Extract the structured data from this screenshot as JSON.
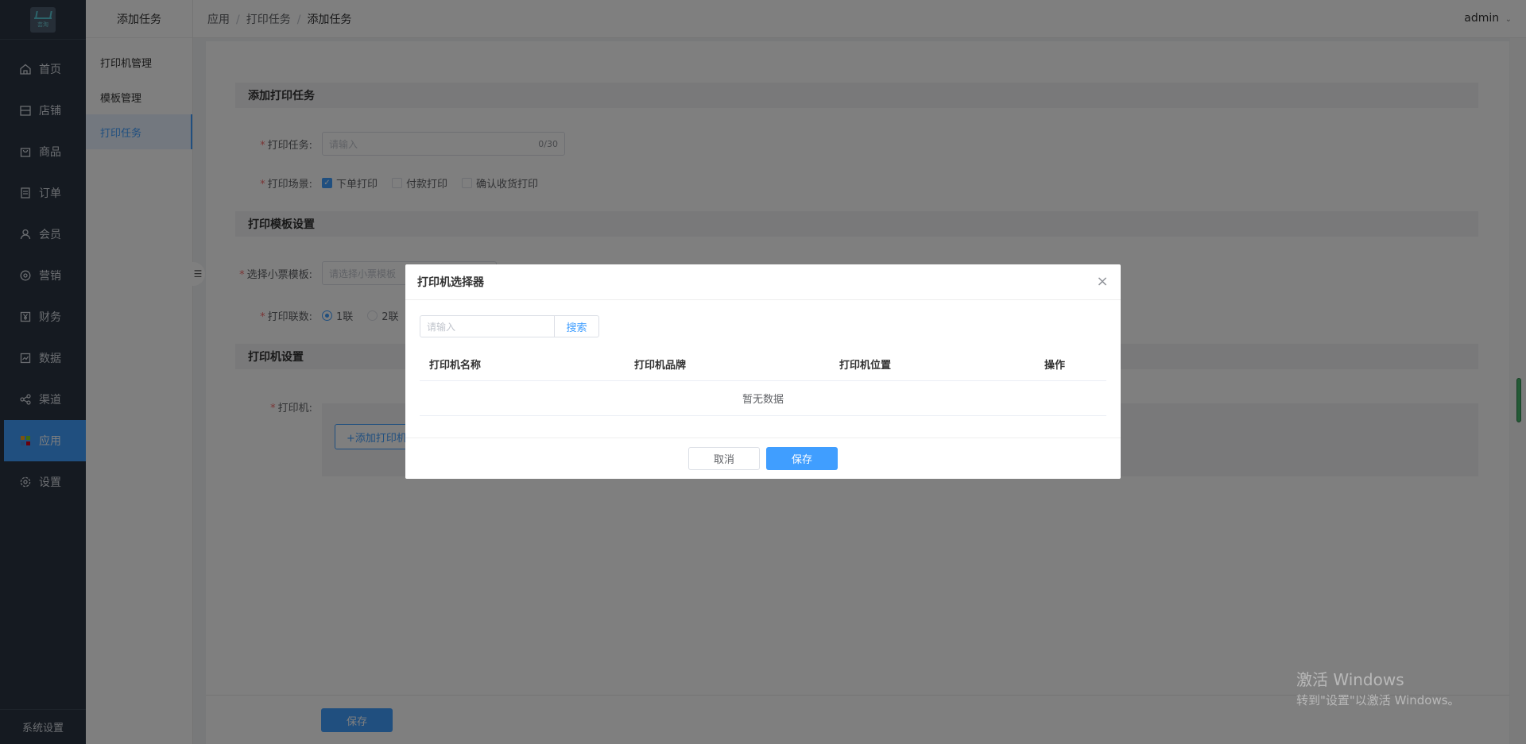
{
  "nav": {
    "logo_text": "芸淘",
    "items": [
      {
        "label": "首页",
        "icon": "home-icon"
      },
      {
        "label": "店铺",
        "icon": "store-icon"
      },
      {
        "label": "商品",
        "icon": "bag-icon"
      },
      {
        "label": "订单",
        "icon": "order-icon"
      },
      {
        "label": "会员",
        "icon": "user-icon"
      },
      {
        "label": "营销",
        "icon": "marketing-icon"
      },
      {
        "label": "财务",
        "icon": "yen-icon"
      },
      {
        "label": "数据",
        "icon": "chart-icon"
      },
      {
        "label": "渠道",
        "icon": "channel-icon"
      },
      {
        "label": "应用",
        "icon": "apps-icon"
      },
      {
        "label": "设置",
        "icon": "gear-icon"
      }
    ],
    "active_index": 9,
    "bottom_label": "系统设置"
  },
  "subnav": {
    "title": "添加任务",
    "items": [
      "打印机管理",
      "模板管理",
      "打印任务"
    ],
    "active_index": 2
  },
  "breadcrumb": [
    "应用",
    "打印任务",
    "添加任务"
  ],
  "user": "admin",
  "form": {
    "section1": "添加打印任务",
    "task_label": "打印任务:",
    "task_placeholder": "请输入",
    "task_count": "0/30",
    "scene_label": "打印场景:",
    "scenes": [
      {
        "label": "下单打印",
        "checked": true
      },
      {
        "label": "付款打印",
        "checked": false
      },
      {
        "label": "确认收货打印",
        "checked": false
      }
    ],
    "section2": "打印模板设置",
    "template_label": "选择小票模板:",
    "template_placeholder": "请选择小票模板",
    "copies_label": "打印联数:",
    "copies": [
      {
        "label": "1联",
        "checked": true
      },
      {
        "label": "2联",
        "checked": false
      }
    ],
    "section3": "打印机设置",
    "printer_label": "打印机:",
    "add_printer": "+添加打印机",
    "save": "保存"
  },
  "modal": {
    "title": "打印机选择器",
    "search_placeholder": "请输入",
    "search_button": "搜索",
    "columns": [
      "打印机名称",
      "打印机品牌",
      "打印机位置",
      "操作"
    ],
    "empty_text": "暂无数据",
    "cancel": "取消",
    "confirm": "保存"
  },
  "watermark": {
    "line1": "激活 Windows",
    "line2": "转到\"设置\"以激活 Windows。"
  },
  "colors": {
    "primary": "#409eff",
    "sidebar": "#2a3542",
    "required": "#f56c6c"
  }
}
